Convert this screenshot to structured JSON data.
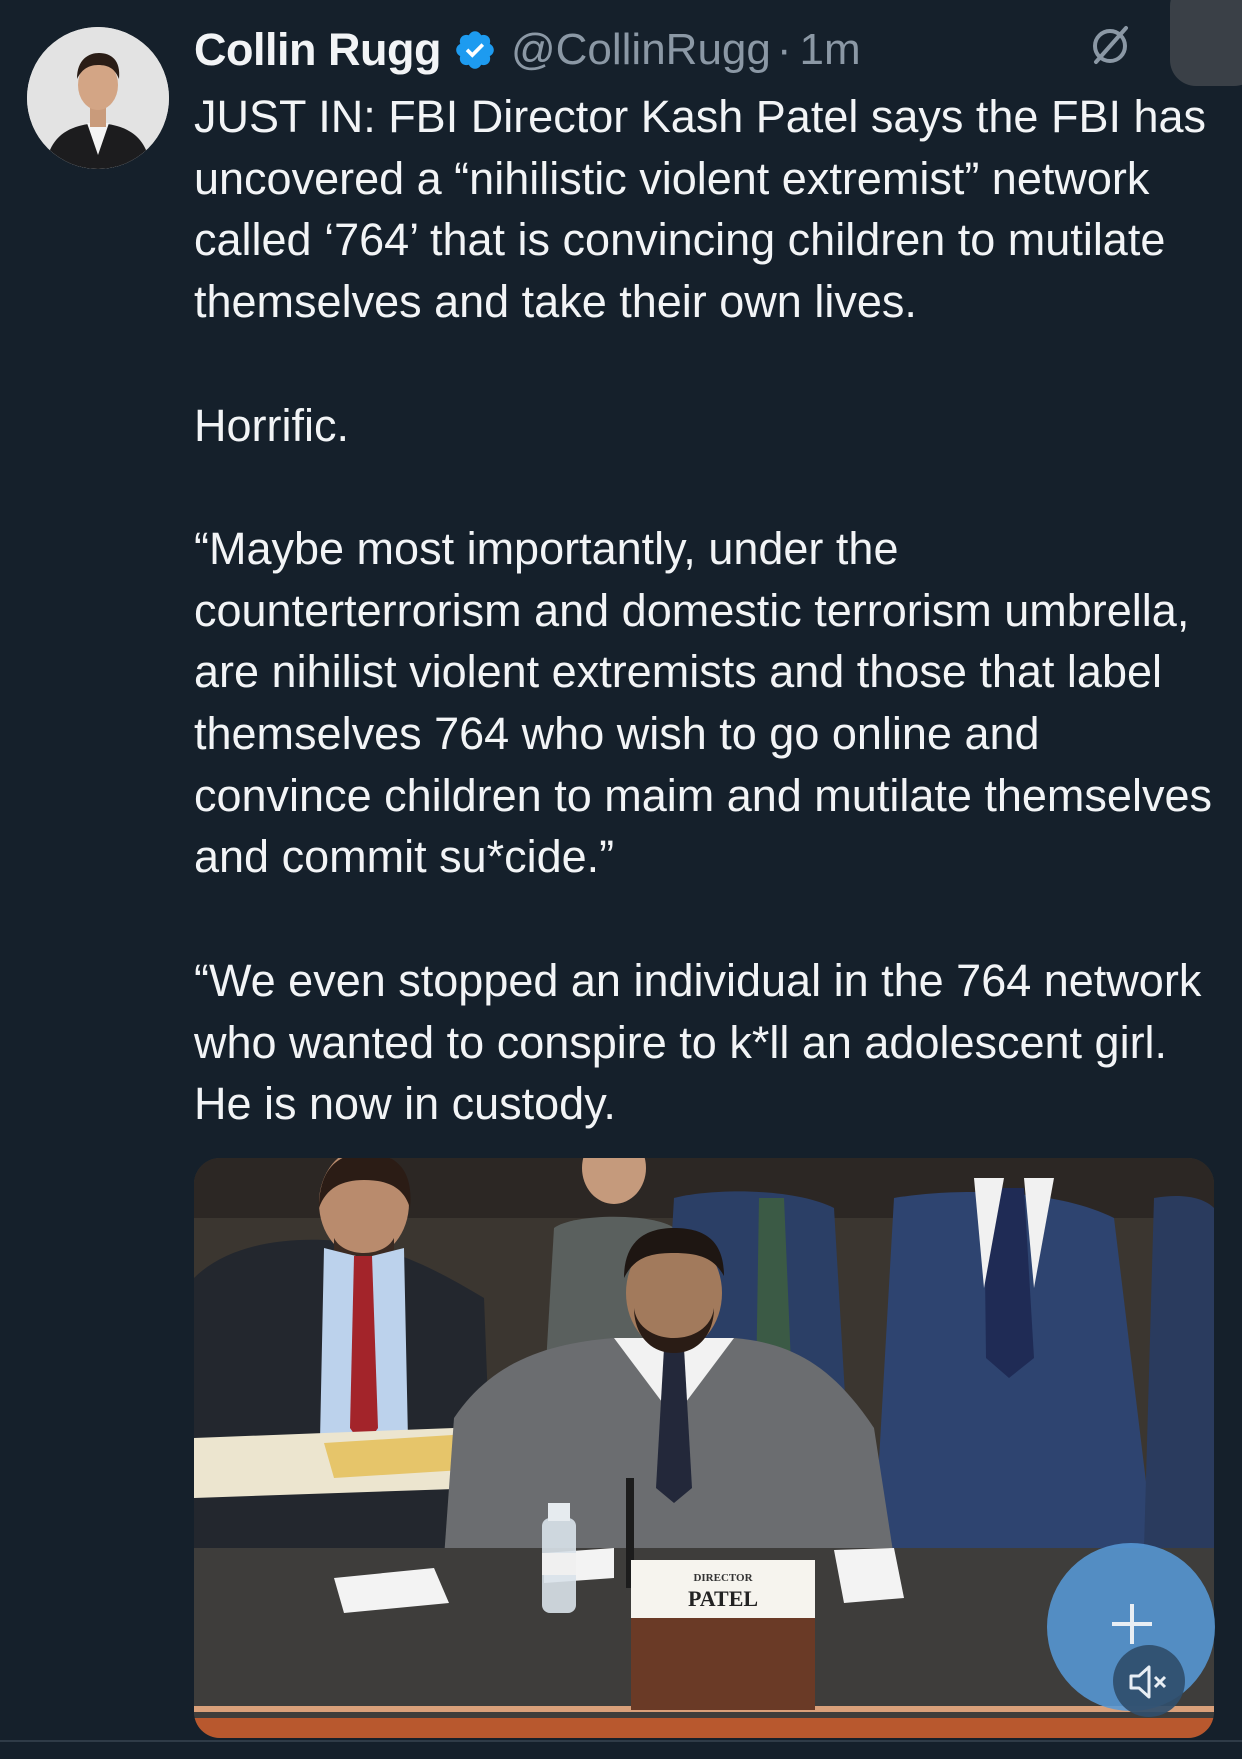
{
  "author": {
    "display_name": "Collin Rugg",
    "handle": "@CollinRugg",
    "separator": "·",
    "time": "1m"
  },
  "icons": {
    "verified": "verified-badge-icon",
    "grok": "grok-icon",
    "compose": "plus-icon",
    "mute": "speaker-muted-icon"
  },
  "colors": {
    "background": "#15202b",
    "verified": "#1d9bf0",
    "secondary_text": "#8b98a5",
    "fab": "#5698d6"
  },
  "tweet": {
    "paragraphs": [
      "JUST IN: FBI Director Kash Patel says the FBI has uncovered a “nihilistic violent extremist” network called ‘764’ that is convincing children to mutilate themselves and take their own lives.",
      "Horrific.",
      "“Maybe most importantly, under the counterterrorism and domestic terrorism umbrella, are nihilist violent extremists and those that label themselves 764 who wish to go online and convince children to maim and mutilate themselves and commit su*cide.”",
      "“We even stopped an individual in the 764 network who wanted to conspire to k*ll an adolescent girl. He is now in custody."
    ]
  },
  "media": {
    "placard_line1": "DIRECTOR",
    "placard_line2": "PATEL"
  }
}
